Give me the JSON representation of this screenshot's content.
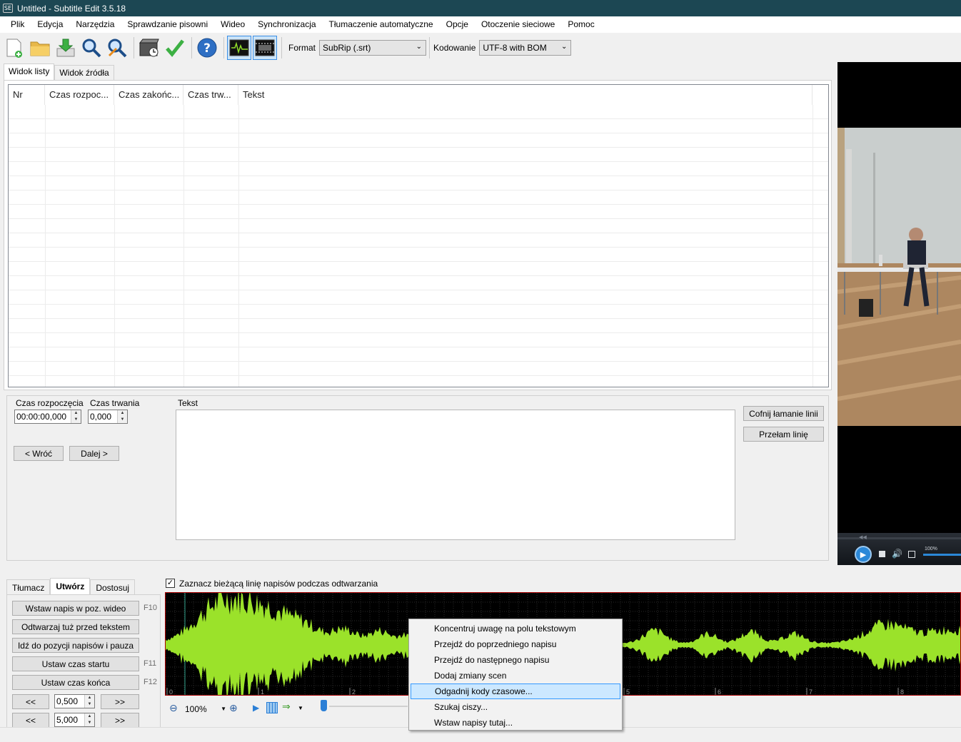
{
  "window": {
    "title": "Untitled - Subtitle Edit 3.5.18",
    "icon_text": "SE"
  },
  "menu": [
    "Plik",
    "Edycja",
    "Narzędzia",
    "Sprawdzanie pisowni",
    "Wideo",
    "Synchronizacja",
    "Tłumaczenie automatyczne",
    "Opcje",
    "Otoczenie sieciowe",
    "Pomoc"
  ],
  "toolbar": {
    "icons": [
      "new-file-icon",
      "open-folder-icon",
      "save-download-icon",
      "find-icon",
      "replace-icon",
      "visual-sync-icon",
      "spell-check-icon",
      "help-icon",
      "waveform-toggle-icon",
      "video-toggle-icon"
    ],
    "format_label": "Format",
    "format_value": "SubRip (.srt)",
    "encoding_label": "Kodowanie",
    "encoding_value": "UTF-8 with BOM"
  },
  "view_tabs": [
    "Widok listy",
    "Widok źródła"
  ],
  "list": {
    "columns": [
      "Nr",
      "Czas rozpoc...",
      "Czas zakońc...",
      "Czas trw...",
      "Tekst"
    ]
  },
  "edit": {
    "start_label": "Czas rozpoczęcia",
    "start_value": "00:00:00,000",
    "duration_label": "Czas trwania",
    "duration_value": "0,000",
    "text_label": "Tekst",
    "prev_button": "< Wróć",
    "next_button": "Dalej >",
    "undo_break_button": "Cofnij łamanie linii",
    "break_button": "Przełam linię"
  },
  "bottom_tabs": [
    "Tłumacz",
    "Utwórz",
    "Dostosuj"
  ],
  "creator": {
    "insert_button": "Wstaw napis w poz. wideo",
    "insert_key": "F10",
    "play_before_button": "Odtwarzaj tuż przed tekstem",
    "goto_pause_button": "Idź do pozycji napisów i pauza",
    "set_start_button": "Ustaw czas startu",
    "set_start_key": "F11",
    "set_end_button": "Ustaw czas końca",
    "set_end_key": "F12",
    "back_label": "<<",
    "fwd_label": ">>",
    "step1_value": "0,500",
    "step2_value": "5,000"
  },
  "waveform": {
    "checkbox_label": "Zaznacz bieżącą linię napisów podczas odtwarzania",
    "zoom_value": "100%",
    "ticks": [
      "0",
      "1",
      "2",
      "5",
      "6",
      "7",
      "8"
    ],
    "wave_color": "#9be22a"
  },
  "video": {
    "volume_label": "100%"
  },
  "context_menu": {
    "items": [
      "Koncentruj uwagę na polu tekstowym",
      "Przejdź do poprzedniego napisu",
      "Przejdź do następnego napisu",
      "Dodaj zmiany scen",
      "Odgadnij kody czasowe...",
      "Szukaj ciszy...",
      "Wstaw napisy tutaj..."
    ],
    "highlighted": "Odgadnij kody czasowe..."
  }
}
